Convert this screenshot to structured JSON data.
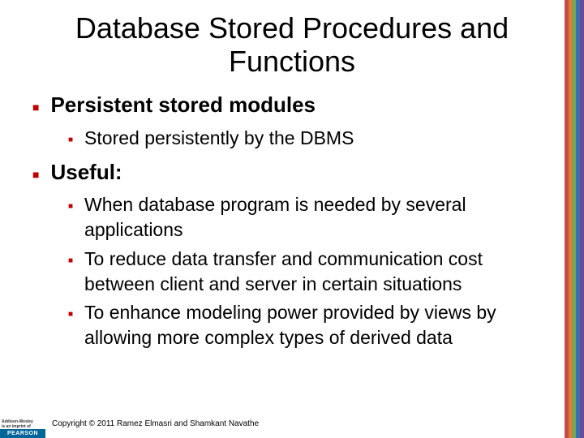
{
  "title": "Database Stored Procedures and Functions",
  "bullets": [
    {
      "text": "Persistent stored modules",
      "children": [
        "Stored persistently by the DBMS"
      ]
    },
    {
      "text": "Useful:",
      "children": [
        "When database program is needed by several applications",
        "To reduce data transfer and communication cost between client and server in certain situations",
        "To enhance modeling power provided by views by allowing more complex types of derived data"
      ]
    }
  ],
  "publisher": {
    "imprint_line1": "Addison-Wesley",
    "imprint_line2": "is an imprint of",
    "brand": "PEARSON"
  },
  "copyright": "Copyright © 2011 Ramez Elmasri and Shamkant Navathe"
}
